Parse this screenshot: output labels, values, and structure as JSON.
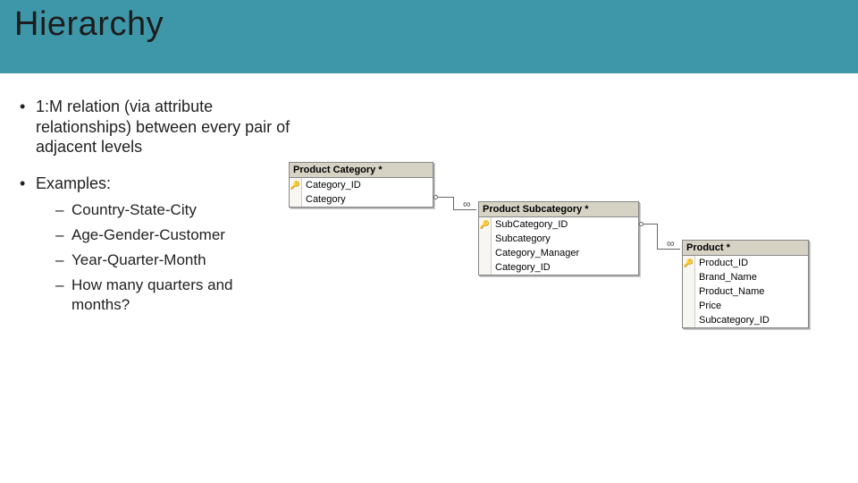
{
  "title": "Hierarchy",
  "bullets": {
    "b1": "1:M relation (via attribute relationships) between every pair of adjacent levels",
    "b2": "Examples:"
  },
  "examples": {
    "0": "Country-State-City",
    "1": "Age-Gender-Customer",
    "2": "Year-Quarter-Month",
    "3": "How many quarters and months?"
  },
  "entity1": {
    "title": "Product Category *",
    "r0": "Category_ID",
    "r1": "Category"
  },
  "entity2": {
    "title": "Product Subcategory *",
    "r0": "SubCategory_ID",
    "r1": "Subcategory",
    "r2": "Category_Manager",
    "r3": "Category_ID"
  },
  "entity3": {
    "title": "Product *",
    "r0": "Product_ID",
    "r1": "Brand_Name",
    "r2": "Product_Name",
    "r3": "Price",
    "r4": "Subcategory_ID"
  }
}
